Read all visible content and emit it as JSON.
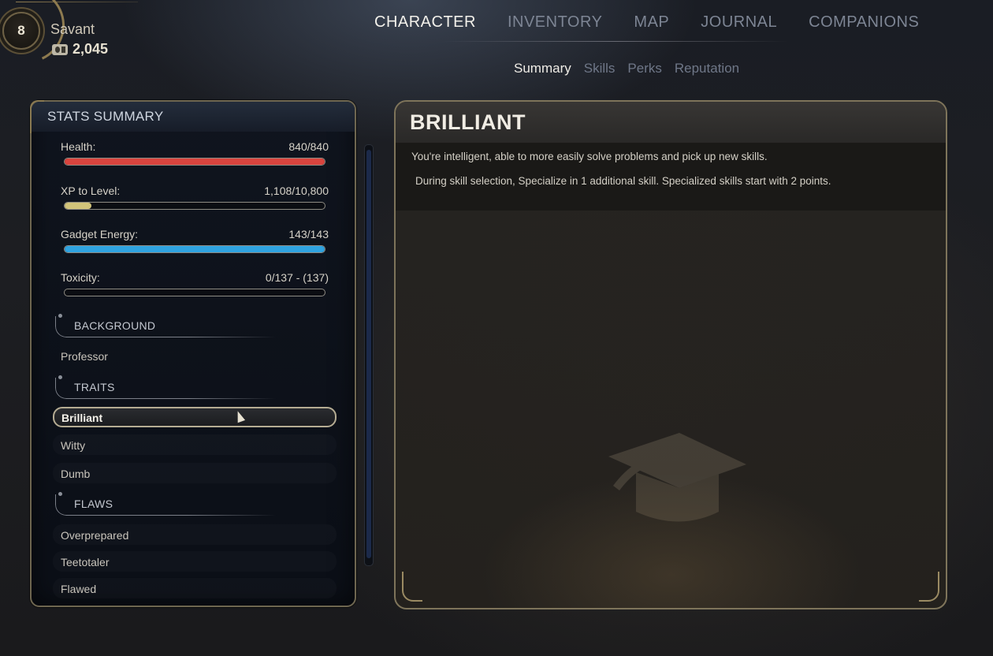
{
  "player": {
    "level": "8",
    "name": "Savant",
    "currency": "2,045",
    "currency_icon": "bit-icon"
  },
  "main_nav": {
    "tabs": [
      {
        "label": "CHARACTER",
        "active": true
      },
      {
        "label": "INVENTORY",
        "active": false
      },
      {
        "label": "MAP",
        "active": false
      },
      {
        "label": "JOURNAL",
        "active": false
      },
      {
        "label": "COMPANIONS",
        "active": false
      }
    ]
  },
  "sub_nav": {
    "tabs": [
      {
        "label": "Summary",
        "active": true
      },
      {
        "label": "Skills",
        "active": false
      },
      {
        "label": "Perks",
        "active": false
      },
      {
        "label": "Reputation",
        "active": false
      }
    ]
  },
  "stats": {
    "title": "STATS SUMMARY",
    "bars": [
      {
        "label": "Health:",
        "value": "840/840",
        "fill": 1.0,
        "color": "#d9443e"
      },
      {
        "label": "XP to Level:",
        "value": "1,108/10,800",
        "fill": 0.1026,
        "color": "#d2c47a"
      },
      {
        "label": "Gadget Energy:",
        "value": "143/143",
        "fill": 1.0,
        "color": "#2fa3e0"
      },
      {
        "label": "Toxicity:",
        "value": "0/137 - (137)",
        "fill": 0.0,
        "color": "#7a7a7a"
      }
    ],
    "sections": {
      "background": {
        "label": "BACKGROUND",
        "items": [
          "Professor"
        ]
      },
      "traits": {
        "label": "TRAITS",
        "items": [
          "Brilliant",
          "Witty",
          "Dumb"
        ],
        "selected": "Brilliant"
      },
      "flaws": {
        "label": "FLAWS",
        "items": [
          "Overprepared",
          "Teetotaler",
          "Flawed"
        ]
      }
    }
  },
  "detail": {
    "title": "BRILLIANT",
    "description": "You're intelligent, able to more easily solve problems and pick up new skills.",
    "effect": "During skill selection, Specialize in 1 additional skill. Specialized skills start with 2 points.",
    "icon": "graduation-cap-icon"
  }
}
